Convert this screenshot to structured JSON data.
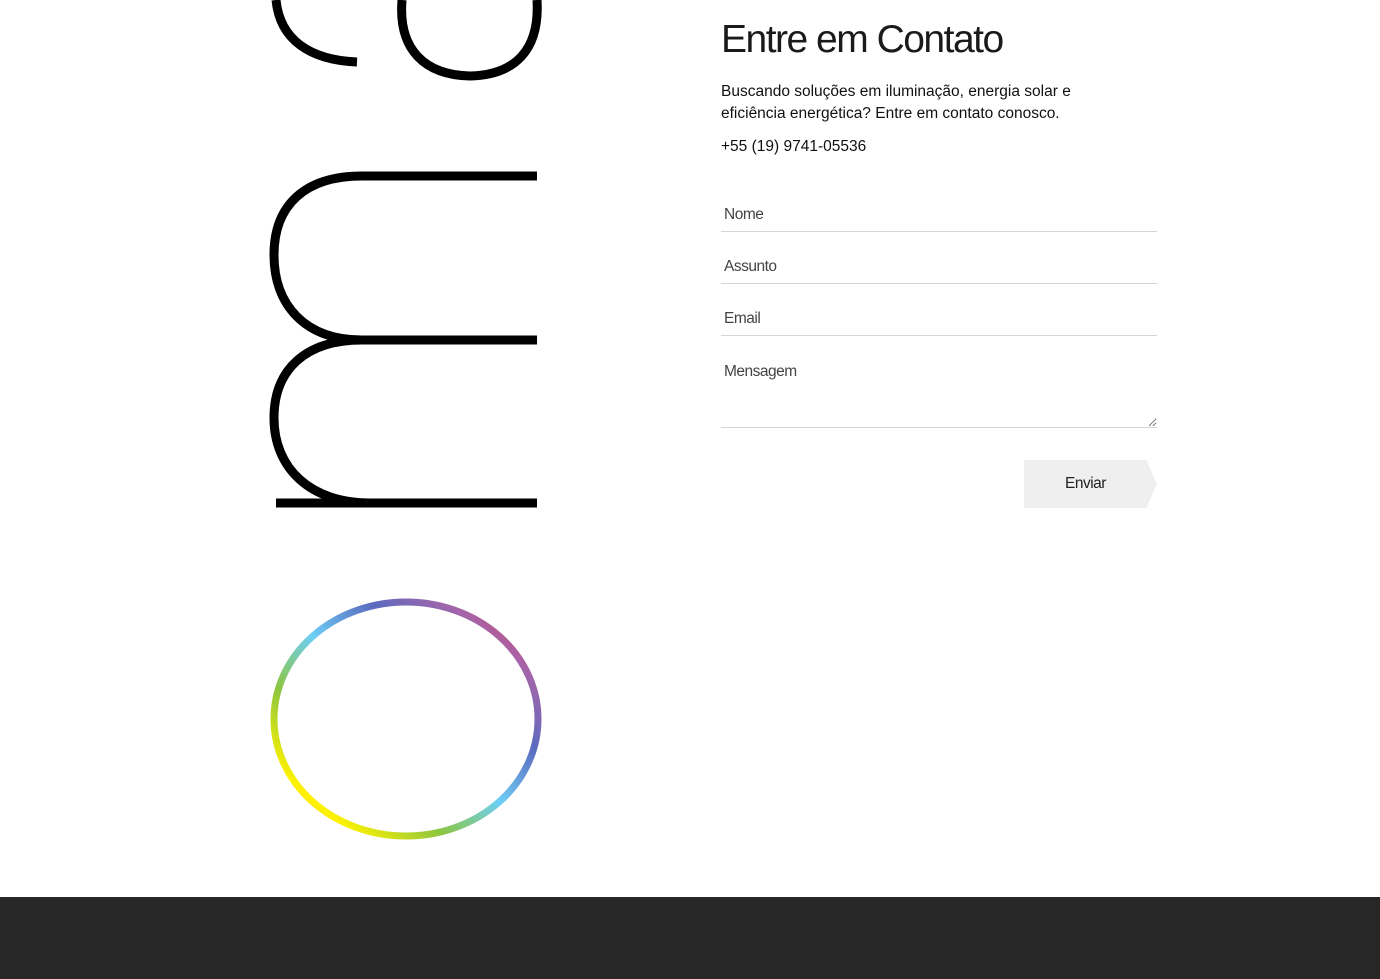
{
  "logo": {
    "description_icon": "rotated-logotype-art",
    "ring_colors": [
      "#ee1c25",
      "#f7941d",
      "#fff200",
      "#8dc63f",
      "#6dcff6",
      "#5b6bc0",
      "#a864a8",
      "#ee1c25"
    ]
  },
  "contact": {
    "title": "Entre em Contato",
    "description": "Buscando soluções em iluminação, energia solar e eficiência energética? Entre em contato conosco.",
    "phone": "+55 (19) 9741-05536"
  },
  "form": {
    "name_placeholder": "Nome",
    "subject_placeholder": "Assunto",
    "email_placeholder": "Email",
    "message_placeholder": "Mensagem",
    "submit_label": "Enviar"
  },
  "colors": {
    "footer_bg": "#272727",
    "button_bg": "#efefef",
    "field_border": "#d6d6d6"
  }
}
